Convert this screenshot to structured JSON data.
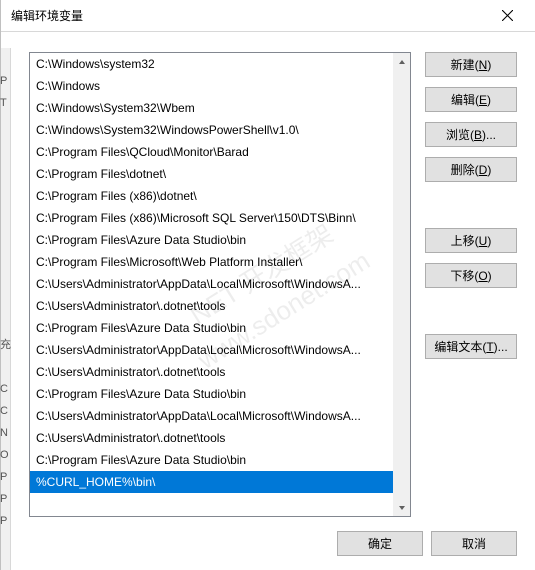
{
  "window": {
    "title": "编辑环境变量"
  },
  "list": {
    "items": [
      "C:\\Windows\\system32",
      "C:\\Windows",
      "C:\\Windows\\System32\\Wbem",
      "C:\\Windows\\System32\\WindowsPowerShell\\v1.0\\",
      "C:\\Program Files\\QCloud\\Monitor\\Barad",
      "C:\\Program Files\\dotnet\\",
      "C:\\Program Files (x86)\\dotnet\\",
      "C:\\Program Files (x86)\\Microsoft SQL Server\\150\\DTS\\Binn\\",
      "C:\\Program Files\\Azure Data Studio\\bin",
      "C:\\Program Files\\Microsoft\\Web Platform Installer\\",
      "C:\\Users\\Administrator\\AppData\\Local\\Microsoft\\WindowsA...",
      "C:\\Users\\Administrator\\.dotnet\\tools",
      "C:\\Program Files\\Azure Data Studio\\bin",
      "C:\\Users\\Administrator\\AppData\\Local\\Microsoft\\WindowsA...",
      "C:\\Users\\Administrator\\.dotnet\\tools",
      "C:\\Program Files\\Azure Data Studio\\bin",
      "C:\\Users\\Administrator\\AppData\\Local\\Microsoft\\WindowsA...",
      "C:\\Users\\Administrator\\.dotnet\\tools",
      "C:\\Program Files\\Azure Data Studio\\bin",
      "%CURL_HOME%\\bin\\"
    ],
    "selected_index": 19
  },
  "buttons": {
    "new": {
      "base": "新建(",
      "accel": "N",
      "tail": ")"
    },
    "edit": {
      "base": "编辑(",
      "accel": "E",
      "tail": ")"
    },
    "browse": {
      "base": "浏览(",
      "accel": "B",
      "tail": ")..."
    },
    "delete": {
      "base": "删除(",
      "accel": "D",
      "tail": ")"
    },
    "moveup": {
      "base": "上移(",
      "accel": "U",
      "tail": ")"
    },
    "movedown": {
      "base": "下移(",
      "accel": "O",
      "tail": ")"
    },
    "edittext": {
      "base": "编辑文本(",
      "accel": "T",
      "tail": ")..."
    }
  },
  "footer": {
    "ok": "确定",
    "cancel": "取消"
  },
  "watermark": {
    "line1": "NET 开发框架",
    "line2": "www.sdonet.com"
  },
  "bg_chars": "P\nT\n\n\n\n\n\n\n\n\n\n\n充\n\nC\nC\nN\nO\nP\nP\nP"
}
